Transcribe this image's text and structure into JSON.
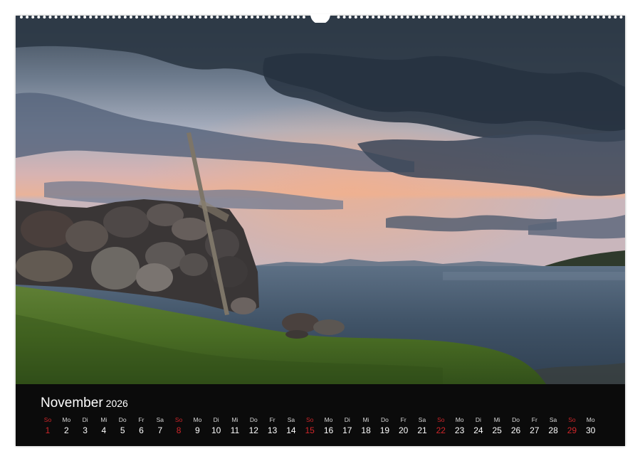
{
  "calendar": {
    "month": "November",
    "year": "2026",
    "days": [
      {
        "weekday": "So",
        "day": "1",
        "sunday": true
      },
      {
        "weekday": "Mo",
        "day": "2",
        "sunday": false
      },
      {
        "weekday": "Di",
        "day": "3",
        "sunday": false
      },
      {
        "weekday": "Mi",
        "day": "4",
        "sunday": false
      },
      {
        "weekday": "Do",
        "day": "5",
        "sunday": false
      },
      {
        "weekday": "Fr",
        "day": "6",
        "sunday": false
      },
      {
        "weekday": "Sa",
        "day": "7",
        "sunday": false
      },
      {
        "weekday": "So",
        "day": "8",
        "sunday": true
      },
      {
        "weekday": "Mo",
        "day": "9",
        "sunday": false
      },
      {
        "weekday": "Di",
        "day": "10",
        "sunday": false
      },
      {
        "weekday": "Mi",
        "day": "11",
        "sunday": false
      },
      {
        "weekday": "Do",
        "day": "12",
        "sunday": false
      },
      {
        "weekday": "Fr",
        "day": "13",
        "sunday": false
      },
      {
        "weekday": "Sa",
        "day": "14",
        "sunday": false
      },
      {
        "weekday": "So",
        "day": "15",
        "sunday": true
      },
      {
        "weekday": "Mo",
        "day": "16",
        "sunday": false
      },
      {
        "weekday": "Di",
        "day": "17",
        "sunday": false
      },
      {
        "weekday": "Mi",
        "day": "18",
        "sunday": false
      },
      {
        "weekday": "Do",
        "day": "19",
        "sunday": false
      },
      {
        "weekday": "Fr",
        "day": "20",
        "sunday": false
      },
      {
        "weekday": "Sa",
        "day": "21",
        "sunday": false
      },
      {
        "weekday": "So",
        "day": "22",
        "sunday": true
      },
      {
        "weekday": "Mo",
        "day": "23",
        "sunday": false
      },
      {
        "weekday": "Di",
        "day": "24",
        "sunday": false
      },
      {
        "weekday": "Mi",
        "day": "25",
        "sunday": false
      },
      {
        "weekday": "Do",
        "day": "26",
        "sunday": false
      },
      {
        "weekday": "Fr",
        "day": "27",
        "sunday": false
      },
      {
        "weekday": "Sa",
        "day": "28",
        "sunday": false
      },
      {
        "weekday": "So",
        "day": "29",
        "sunday": true
      },
      {
        "weekday": "Mo",
        "day": "30",
        "sunday": false
      }
    ]
  },
  "colors": {
    "sunday": "#d0262a",
    "bar_background": "#0b0b0b",
    "text": "#ffffff"
  },
  "photo": {
    "subject": "coastal-landscape"
  }
}
